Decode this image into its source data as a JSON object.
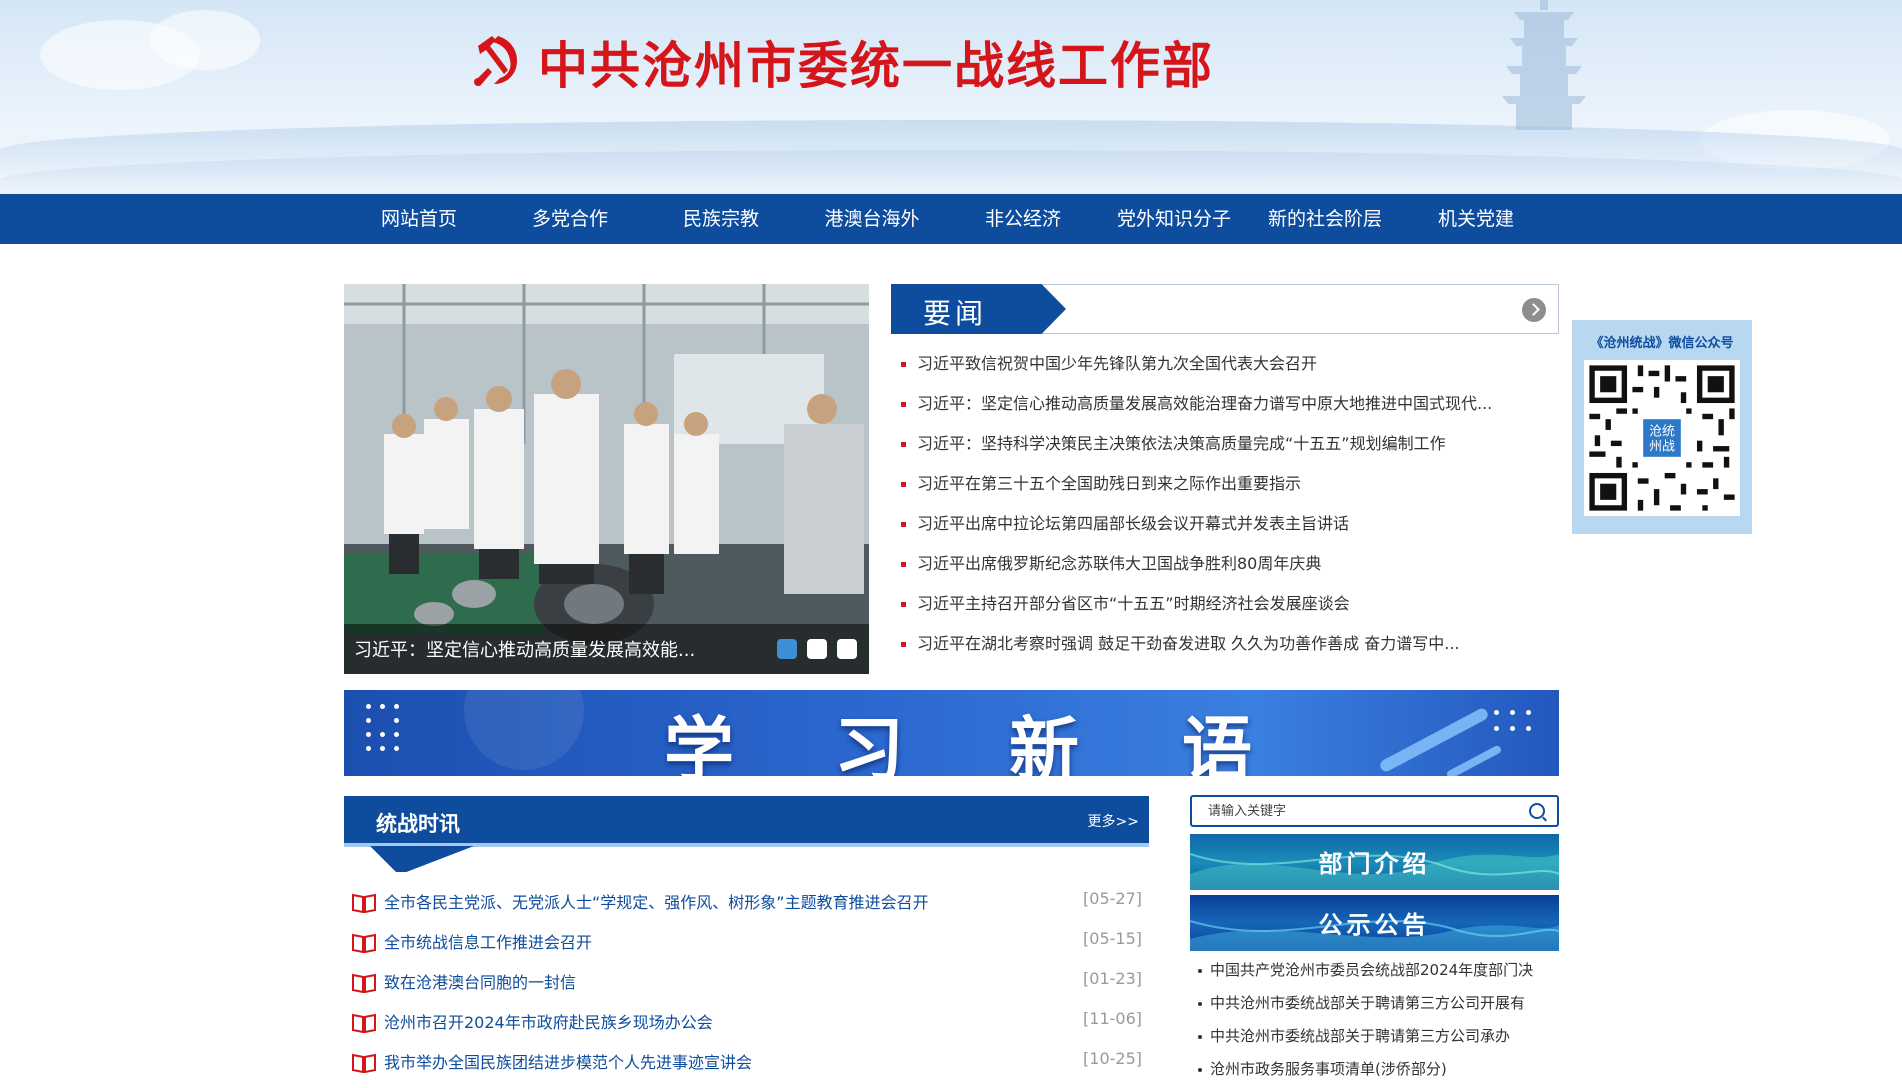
{
  "header": {
    "title": "中共沧州市委统一战线工作部",
    "emblem_icon": "party-emblem-icon",
    "brand_color": "#d4161b"
  },
  "nav": {
    "color": "#0e4c9e",
    "items": [
      {
        "label": "网站首页"
      },
      {
        "label": "多党合作"
      },
      {
        "label": "民族宗教"
      },
      {
        "label": "港澳台海外"
      },
      {
        "label": "非公经济"
      },
      {
        "label": "党外知识分子"
      },
      {
        "label": "新的社会阶层"
      },
      {
        "label": "机关党建"
      }
    ]
  },
  "slider": {
    "caption": "习近平：坚定信心推动高质量发展高效能...",
    "slide_count": 3,
    "active_slide": 1
  },
  "headlines": {
    "title": "要闻",
    "more_icon": "chevron-right-circle-icon",
    "items": [
      "习近平致信祝贺中国少年先锋队第九次全国代表大会召开",
      "习近平：坚定信心推动高质量发展高效能治理奋力谱写中原大地推进中国式现代...",
      "习近平：坚持科学决策民主决策依法决策高质量完成“十五五”规划编制工作",
      "习近平在第三十五个全国助残日到来之际作出重要指示",
      "习近平出席中拉论坛第四届部长级会议开幕式并发表主旨讲话",
      "习近平出席俄罗斯纪念苏联伟大卫国战争胜利80周年庆典",
      "习近平主持召开部分省区市“十五五”时期经济社会发展座谈会",
      "习近平在湖北考察时强调 鼓足干劲奋发进取 久久为功善作善成 奋力谱写中..."
    ]
  },
  "qr": {
    "title": "《沧州统战》微信公众号",
    "center_label": "沧统州战"
  },
  "study": {
    "chars": [
      "学",
      "习",
      "新",
      "语"
    ]
  },
  "united_front_news": {
    "title": "统战时讯",
    "more": "更多>>",
    "items": [
      {
        "title": "全市各民主党派、无党派人士“学规定、强作风、树形象”主题教育推进会召开",
        "date": "[05-27]"
      },
      {
        "title": "全市统战信息工作推进会召开",
        "date": "[05-15]"
      },
      {
        "title": "致在沧港澳台同胞的一封信",
        "date": "[01-23]"
      },
      {
        "title": "沧州市召开2024年市政府赴民族乡现场办公会",
        "date": "[11-06]"
      },
      {
        "title": "我市举办全国民族团结进步模范个人先进事迹宣讲会",
        "date": "[10-25]"
      }
    ]
  },
  "search": {
    "placeholder": "请输入关键字",
    "value": ""
  },
  "sidebar": {
    "dept_intro": "部门介绍",
    "notices_title": "公示公告",
    "notices": [
      "中国共产党沧州市委员会统战部2024年度部门决",
      "中共沧州市委统战部关于聘请第三方公司开展有",
      "中共沧州市委统战部关于聘请第三方公司承办",
      "沧州市政务服务事项清单(涉侨部分)"
    ]
  }
}
